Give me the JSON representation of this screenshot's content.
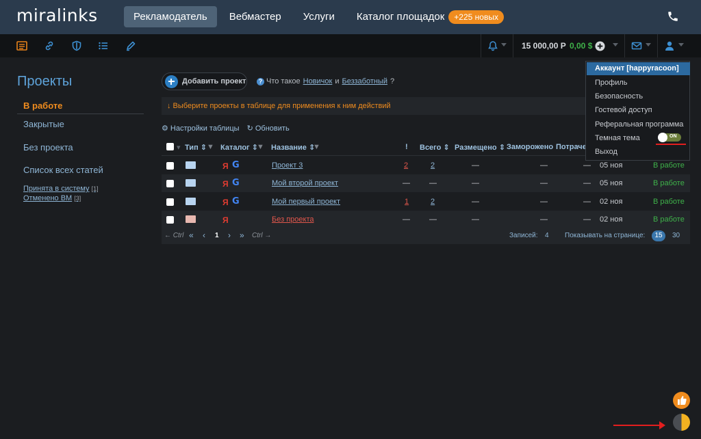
{
  "header": {
    "logo": "miralinks",
    "nav": [
      {
        "label": "Рекламодатель",
        "active": true
      },
      {
        "label": "Вебмастер",
        "active": false
      },
      {
        "label": "Услуги",
        "active": false
      },
      {
        "label": "Каталог площадок",
        "active": false
      }
    ],
    "catalog_badge": "+225 новых",
    "accent_color": "#f08c1e",
    "bar_color": "#2b3b4d"
  },
  "subbar": {
    "icons": [
      "list-icon",
      "link-icon",
      "shield-icon",
      "bullet-list-icon",
      "pen-icon"
    ],
    "balance_rub": "15 000,00 Р",
    "balance_usd": "0,00 $"
  },
  "sidebar": {
    "title": "Проекты",
    "active": "В работе",
    "items": [
      "Закрытые",
      "Без проекта",
      "Список всех статей"
    ],
    "small_links": [
      {
        "label": "Принята в систему",
        "count": "[1]"
      },
      {
        "label": "Отменено ВМ",
        "count": "[3]"
      }
    ]
  },
  "main": {
    "add_project": "Добавить проект",
    "whatis": {
      "prefix": "Что такое",
      "link1": "Новичок",
      "middle": "и",
      "link2": "Беззаботный",
      "suffix": "?"
    },
    "hint": "↓ Выберите проекты в таблице для применения к ним действий",
    "tools": {
      "settings": "Настройки таблицы",
      "refresh": "Обновить"
    },
    "columns": [
      "Тип",
      "Каталог",
      "Название",
      "!",
      "Всего",
      "Размещено",
      "Заморожено",
      "Потрачено"
    ],
    "rows": [
      {
        "name": "Проект 3",
        "catalogs": [
          "Я",
          "G"
        ],
        "excl": "2",
        "total": "2",
        "placed": "—",
        "frozen": "—",
        "spent": "—",
        "date": "05 ноя",
        "status": "В работе",
        "red": false
      },
      {
        "name": "Мой второй проект",
        "catalogs": [
          "Я",
          "G"
        ],
        "excl": "—",
        "total": "—",
        "placed": "—",
        "frozen": "—",
        "spent": "—",
        "date": "05 ноя",
        "status": "В работе",
        "red": false
      },
      {
        "name": "Мой первый проект",
        "catalogs": [
          "Я",
          "G"
        ],
        "excl": "1",
        "total": "2",
        "placed": "—",
        "frozen": "—",
        "spent": "—",
        "date": "02 ноя",
        "status": "В работе",
        "red": false
      },
      {
        "name": "Без проекта",
        "catalogs": [
          "Я"
        ],
        "excl": "—",
        "total": "—",
        "placed": "—",
        "frozen": "—",
        "spent": "—",
        "date": "02 ноя",
        "status": "В работе",
        "red": true
      }
    ],
    "pager": {
      "prev_hint": "← Ctrl",
      "first": "«",
      "prev": "‹",
      "page": "1",
      "next": "›",
      "last": "»",
      "next_hint": "Ctrl →",
      "records_label": "Записей:",
      "records": "4",
      "per_page_label": "Показывать на странице:",
      "per_page_selected": "15",
      "per_page_other": "30"
    }
  },
  "account_menu": {
    "header": "Аккаунт [happyracoon]",
    "items": [
      "Профиль",
      "Безопасность",
      "Гостевой доступ",
      "Реферальная программа",
      "Темная тема",
      "Выход"
    ],
    "toggle_label": "ON",
    "dark_theme_on": true
  }
}
